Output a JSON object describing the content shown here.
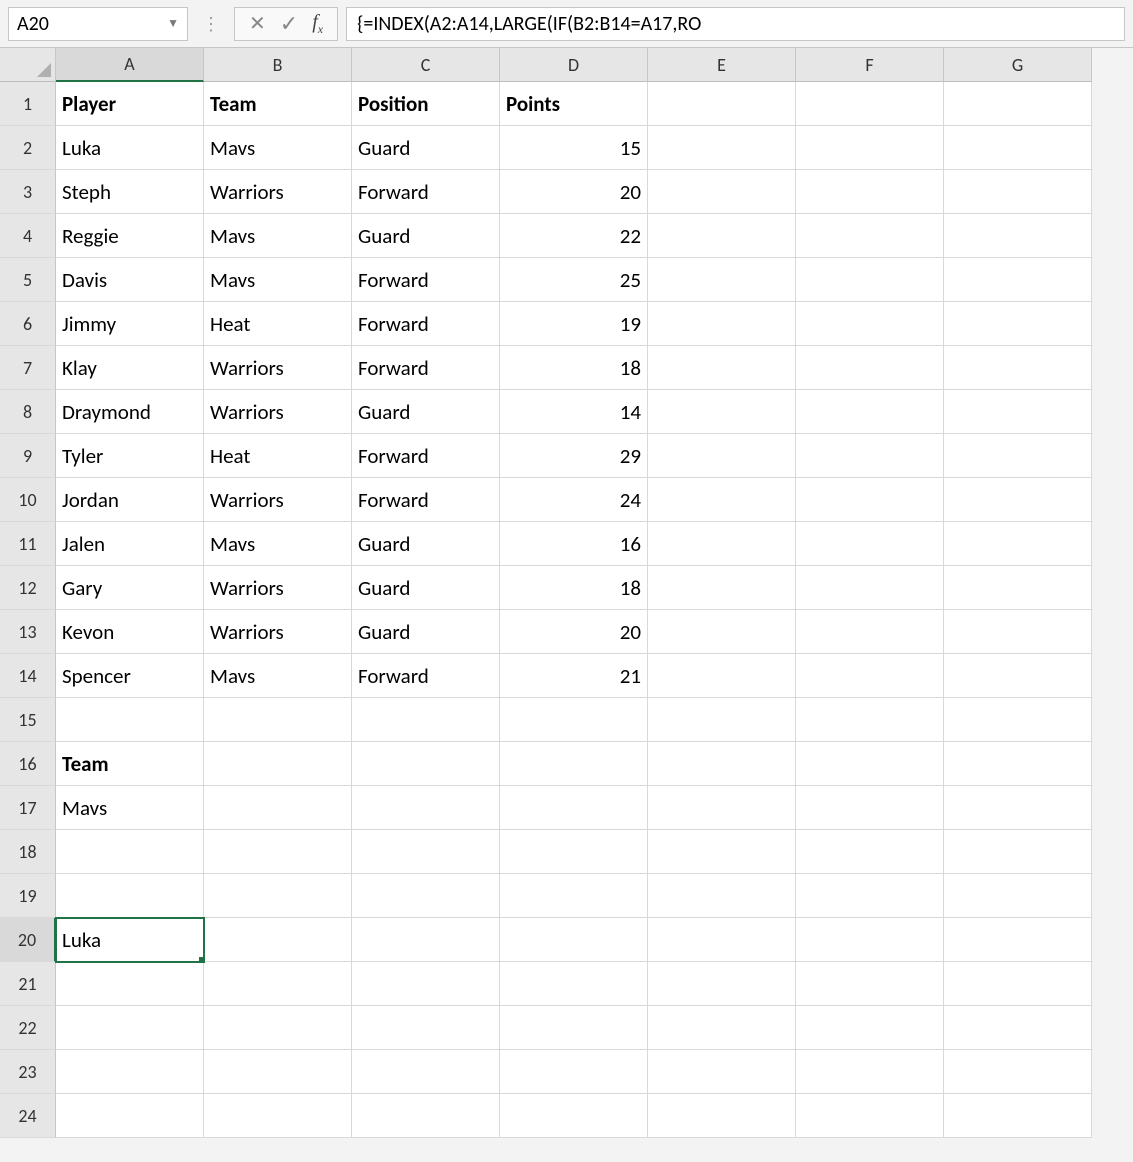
{
  "formula_bar": {
    "name_box": "A20",
    "formula": "{=INDEX(A2:A14,LARGE(IF(B2:B14=A17,RO"
  },
  "columns": [
    "A",
    "B",
    "C",
    "D",
    "E",
    "F",
    "G"
  ],
  "col_widths": {
    "A": 148,
    "B": 148,
    "C": 148,
    "D": 148,
    "E": 148,
    "F": 148,
    "G": 148
  },
  "row_count": 24,
  "selected_cell": "A20",
  "selected_row": 20,
  "selected_col": "A",
  "cells": {
    "A1": {
      "v": "Player",
      "bold": true
    },
    "B1": {
      "v": "Team",
      "bold": true
    },
    "C1": {
      "v": "Position",
      "bold": true
    },
    "D1": {
      "v": "Points",
      "bold": true
    },
    "A2": {
      "v": "Luka"
    },
    "B2": {
      "v": "Mavs"
    },
    "C2": {
      "v": "Guard"
    },
    "D2": {
      "v": 15,
      "align": "right"
    },
    "A3": {
      "v": "Steph"
    },
    "B3": {
      "v": "Warriors"
    },
    "C3": {
      "v": "Forward"
    },
    "D3": {
      "v": 20,
      "align": "right"
    },
    "A4": {
      "v": "Reggie"
    },
    "B4": {
      "v": "Mavs"
    },
    "C4": {
      "v": "Guard"
    },
    "D4": {
      "v": 22,
      "align": "right"
    },
    "A5": {
      "v": "Davis"
    },
    "B5": {
      "v": "Mavs"
    },
    "C5": {
      "v": "Forward"
    },
    "D5": {
      "v": 25,
      "align": "right"
    },
    "A6": {
      "v": "Jimmy"
    },
    "B6": {
      "v": "Heat"
    },
    "C6": {
      "v": "Forward"
    },
    "D6": {
      "v": 19,
      "align": "right"
    },
    "A7": {
      "v": "Klay"
    },
    "B7": {
      "v": "Warriors"
    },
    "C7": {
      "v": "Forward"
    },
    "D7": {
      "v": 18,
      "align": "right"
    },
    "A8": {
      "v": "Draymond"
    },
    "B8": {
      "v": "Warriors"
    },
    "C8": {
      "v": "Guard"
    },
    "D8": {
      "v": 14,
      "align": "right"
    },
    "A9": {
      "v": "Tyler"
    },
    "B9": {
      "v": "Heat"
    },
    "C9": {
      "v": "Forward"
    },
    "D9": {
      "v": 29,
      "align": "right"
    },
    "A10": {
      "v": "Jordan"
    },
    "B10": {
      "v": "Warriors"
    },
    "C10": {
      "v": "Forward"
    },
    "D10": {
      "v": 24,
      "align": "right"
    },
    "A11": {
      "v": "Jalen"
    },
    "B11": {
      "v": "Mavs"
    },
    "C11": {
      "v": "Guard"
    },
    "D11": {
      "v": 16,
      "align": "right"
    },
    "A12": {
      "v": "Gary"
    },
    "B12": {
      "v": "Warriors"
    },
    "C12": {
      "v": "Guard"
    },
    "D12": {
      "v": 18,
      "align": "right"
    },
    "A13": {
      "v": "Kevon"
    },
    "B13": {
      "v": "Warriors"
    },
    "C13": {
      "v": "Guard"
    },
    "D13": {
      "v": 20,
      "align": "right"
    },
    "A14": {
      "v": "Spencer"
    },
    "B14": {
      "v": "Mavs"
    },
    "C14": {
      "v": "Forward"
    },
    "D14": {
      "v": 21,
      "align": "right"
    },
    "A16": {
      "v": "Team",
      "bold": true
    },
    "A17": {
      "v": "Mavs"
    },
    "A20": {
      "v": "Luka"
    }
  },
  "chart_data": {
    "type": "table",
    "headers": [
      "Player",
      "Team",
      "Position",
      "Points"
    ],
    "rows": [
      [
        "Luka",
        "Mavs",
        "Guard",
        15
      ],
      [
        "Steph",
        "Warriors",
        "Forward",
        20
      ],
      [
        "Reggie",
        "Mavs",
        "Guard",
        22
      ],
      [
        "Davis",
        "Mavs",
        "Forward",
        25
      ],
      [
        "Jimmy",
        "Heat",
        "Forward",
        19
      ],
      [
        "Klay",
        "Warriors",
        "Forward",
        18
      ],
      [
        "Draymond",
        "Warriors",
        "Guard",
        14
      ],
      [
        "Tyler",
        "Heat",
        "Forward",
        29
      ],
      [
        "Jordan",
        "Warriors",
        "Forward",
        24
      ],
      [
        "Jalen",
        "Mavs",
        "Guard",
        16
      ],
      [
        "Gary",
        "Warriors",
        "Guard",
        18
      ],
      [
        "Kevon",
        "Warriors",
        "Guard",
        20
      ],
      [
        "Spencer",
        "Mavs",
        "Forward",
        21
      ]
    ],
    "lookups": {
      "Team": "Mavs",
      "result": "Luka"
    }
  }
}
